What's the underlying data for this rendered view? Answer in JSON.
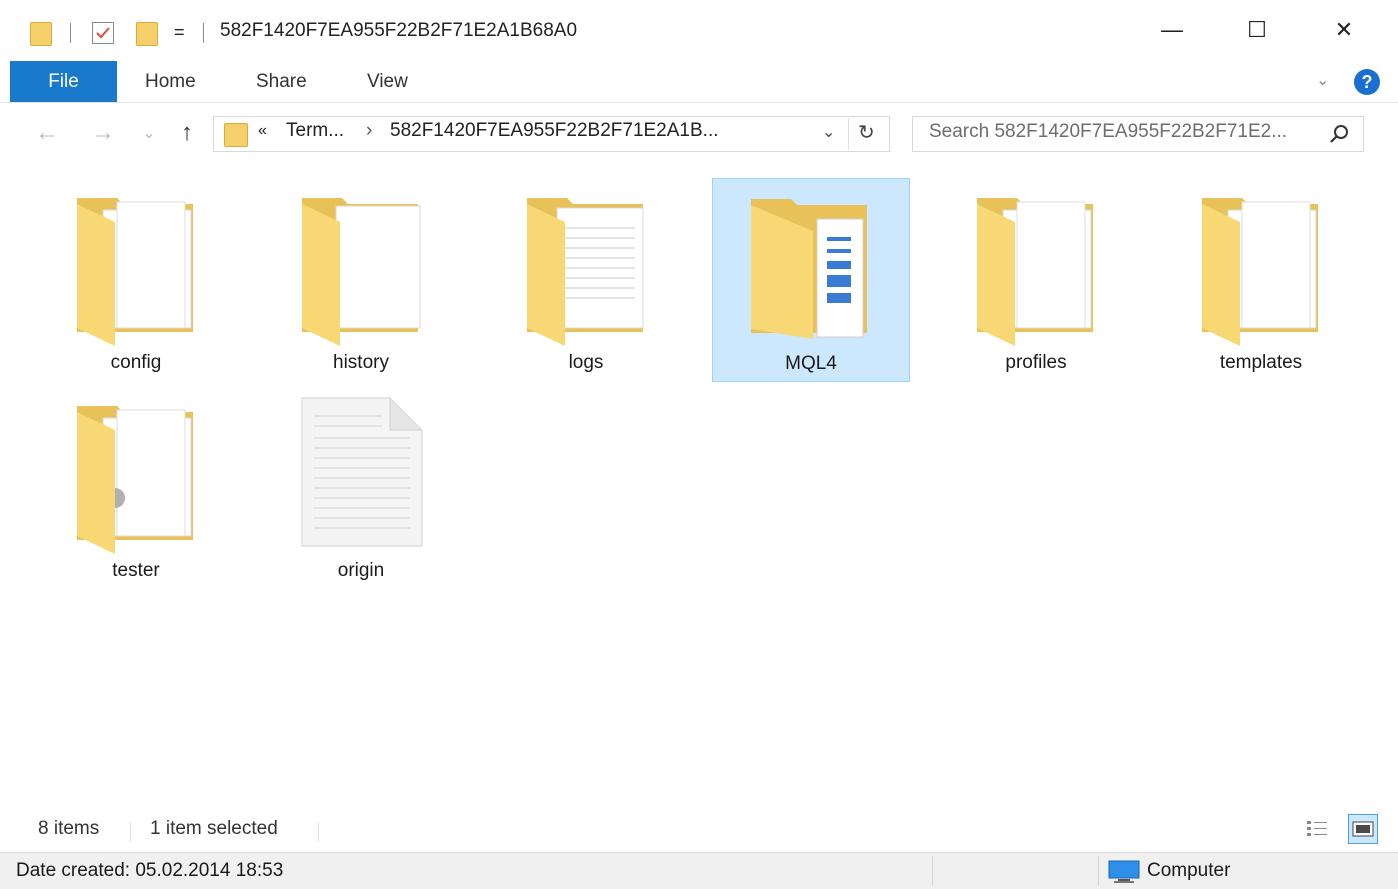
{
  "window": {
    "title": "582F1420F7EA955F22B2F71E2A1B68A0",
    "qat_dropdown": "=",
    "controls": {
      "minimize": "—",
      "maximize": "☐",
      "close": "✕"
    }
  },
  "ribbon": {
    "tabs": [
      {
        "label": "File"
      },
      {
        "label": "Home"
      },
      {
        "label": "Share"
      },
      {
        "label": "View"
      }
    ],
    "collapse_glyph": "⌄",
    "help_glyph": "?"
  },
  "nav": {
    "back_glyph": "←",
    "forward_glyph": "→",
    "recent_glyph": "⌄",
    "up_glyph": "↑",
    "address": {
      "overflow_glyph": "«",
      "crumbs": [
        "Term...",
        "582F1420F7EA955F22B2F71E2A1B..."
      ],
      "separator": "›",
      "dropdown_glyph": "⌄",
      "refresh_glyph": "↻"
    },
    "search": {
      "placeholder": "Search 582F1420F7EA955F22B2F71E2..."
    }
  },
  "items": [
    {
      "name": "config",
      "kind": "folder",
      "selected": false
    },
    {
      "name": "history",
      "kind": "folder",
      "selected": false
    },
    {
      "name": "logs",
      "kind": "folder",
      "selected": false
    },
    {
      "name": "MQL4",
      "kind": "folder",
      "selected": true
    },
    {
      "name": "profiles",
      "kind": "folder",
      "selected": false
    },
    {
      "name": "templates",
      "kind": "folder",
      "selected": false
    },
    {
      "name": "tester",
      "kind": "folder",
      "selected": false
    },
    {
      "name": "origin",
      "kind": "file",
      "selected": false
    }
  ],
  "status": {
    "item_count": "8 items",
    "selection": "1 item selected"
  },
  "info": {
    "date_created": "Date created: 05.02.2014 18:53",
    "location": "Computer"
  },
  "colors": {
    "accent": "#1979ca",
    "selection_bg": "#cce8ff",
    "selection_border": "#99d1ff",
    "folder": "#f5cf6a"
  }
}
